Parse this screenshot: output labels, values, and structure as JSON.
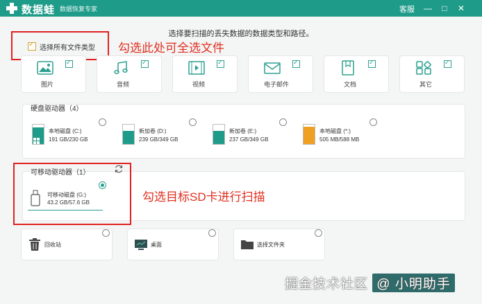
{
  "app": {
    "name": "数据蛙",
    "subtitle": "数据恢复专家",
    "support": "客服"
  },
  "window_controls": [
    "—",
    "□",
    "✕"
  ],
  "instruction": "选择要扫描的丢失数据的数据类型和路径。",
  "select_all": {
    "label": "选择所有文件类型",
    "checked": true
  },
  "annotations": {
    "select_all": "勾选此处可全选文件",
    "sd_card": "勾选目标SD卡进行扫描"
  },
  "file_types": [
    {
      "label": "图片",
      "icon": "image-icon",
      "checked": true
    },
    {
      "label": "音频",
      "icon": "music-icon",
      "checked": true
    },
    {
      "label": "视频",
      "icon": "video-icon",
      "checked": true
    },
    {
      "label": "电子邮件",
      "icon": "email-icon",
      "checked": true
    },
    {
      "label": "文档",
      "icon": "document-icon",
      "checked": true
    },
    {
      "label": "其它",
      "icon": "other-icon",
      "checked": true
    }
  ],
  "hard_drives": {
    "title": "硬盘驱动器（4）",
    "drives": [
      {
        "name": "本地磁盘 (C:)",
        "size": "191 GB/230 GB",
        "fill": 0.83,
        "color": "#1f9b8a",
        "windows": true
      },
      {
        "name": "新加卷 (D:)",
        "size": "239 GB/349 GB",
        "fill": 0.68,
        "color": "#1f9b8a",
        "windows": false
      },
      {
        "name": "新加卷 (E:)",
        "size": "237 GB/349 GB",
        "fill": 0.68,
        "color": "#1f9b8a",
        "windows": false
      },
      {
        "name": "本地磁盘 (*:)",
        "size": "505 MB/588 MB",
        "fill": 0.86,
        "color": "#f0a020",
        "windows": false
      }
    ]
  },
  "removable": {
    "title": "可移动驱动器（1）",
    "drive": {
      "name": "可移动磁盘 (G:)",
      "size": "43.2 GB/57.6 GB",
      "selected": true
    }
  },
  "locations": [
    {
      "label": "回收站",
      "icon": "recycle-bin-icon"
    },
    {
      "label": "桌面",
      "icon": "desktop-icon"
    },
    {
      "label": "选择文件夹",
      "icon": "folder-icon"
    }
  ],
  "watermark": {
    "prefix": "掘金技术社区",
    "user": "@ 小明助手"
  }
}
